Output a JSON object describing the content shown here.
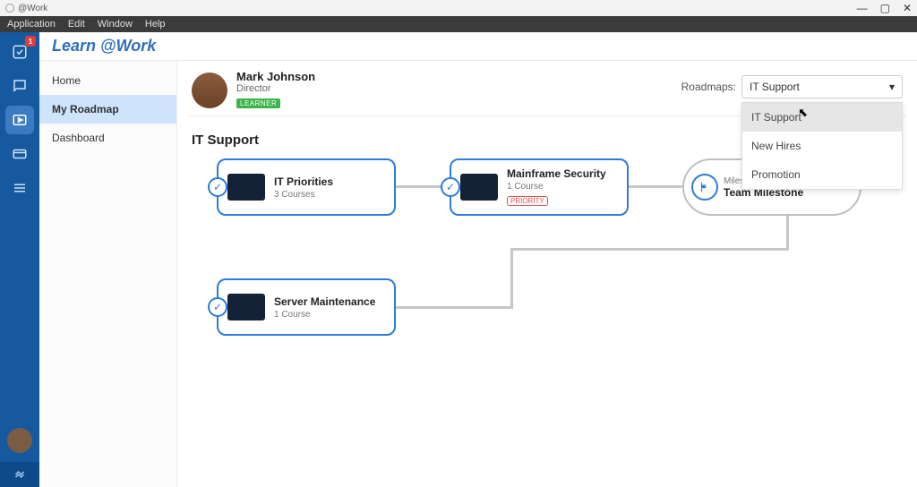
{
  "window": {
    "title": "@Work"
  },
  "menubar": [
    "Application",
    "Edit",
    "Window",
    "Help"
  ],
  "rail": {
    "badge": "1"
  },
  "brand": "Learn @Work",
  "sidenav": {
    "items": [
      {
        "label": "Home",
        "active": false
      },
      {
        "label": "My Roadmap",
        "active": true
      },
      {
        "label": "Dashboard",
        "active": false
      }
    ]
  },
  "profile": {
    "name": "Mark Johnson",
    "role": "Director",
    "badge": "LEARNER"
  },
  "roadmap": {
    "label": "Roadmaps:",
    "selected": "IT Support",
    "options": [
      "IT Support",
      "New Hires",
      "Promotion"
    ]
  },
  "section": "IT Support",
  "cards": {
    "it_priorities": {
      "title": "IT Priorities",
      "subtitle": "3 Courses"
    },
    "mainframe": {
      "title": "Mainframe Security",
      "subtitle": "1 Course",
      "priority": "PRIORITY"
    },
    "milestone": {
      "label": "Milestone",
      "title": "Team Milestone"
    },
    "server": {
      "title": "Server Maintenance",
      "subtitle": "1 Course"
    }
  }
}
